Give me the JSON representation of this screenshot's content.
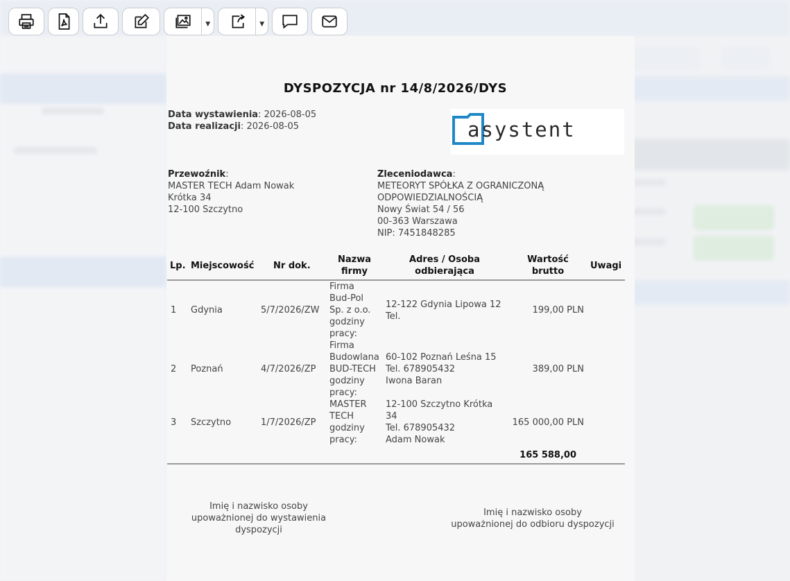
{
  "toolbar": {
    "buttons": [
      {
        "name": "print-button",
        "icon": "printer-icon"
      },
      {
        "name": "pdf-button",
        "icon": "pdf-icon"
      },
      {
        "name": "export-button",
        "icon": "upload-icon"
      },
      {
        "name": "edit-button",
        "icon": "edit-icon"
      },
      {
        "name": "image-button",
        "icon": "image-icon"
      },
      {
        "name": "share-button",
        "icon": "share-icon"
      },
      {
        "name": "comment-button",
        "icon": "comment-icon"
      },
      {
        "name": "email-button",
        "icon": "envelope-icon"
      }
    ]
  },
  "document": {
    "title": "DYSPOZYCJA nr 14/8/2026/DYS",
    "issue_date_label": "Data wystawienia",
    "issue_date": "2026-08-05",
    "realization_date_label": "Data realizacji",
    "realization_date": "2026-08-05",
    "logo_text": "asystent",
    "carrier": {
      "label": "Przewoźnik",
      "lines": [
        "MASTER TECH Adam Nowak",
        "Krótka 34",
        "12-100 Szczytno"
      ]
    },
    "client": {
      "label": "Zleceniodawca",
      "lines": [
        "METEORYT SPÓŁKA Z OGRANICZONĄ",
        "ODPOWIEDZIALNOŚCIĄ",
        "Nowy Świat 54 / 56",
        "00-363 Warszawa",
        "NIP: 7451848285"
      ]
    },
    "table": {
      "headers": {
        "lp": "Lp.",
        "city": "Miejscowość",
        "doc_no": "Nr dok.",
        "company_1": "Nazwa",
        "company_2": "firmy",
        "address_1": "Adres / Osoba",
        "address_2": "odbierająca",
        "value_1": "Wartość",
        "value_2": "brutto",
        "notes": "Uwagi"
      },
      "rows": [
        {
          "lp": "1",
          "city": "Gdynia",
          "doc_no": "5/7/2026/ZW",
          "company": [
            "Firma",
            "Bud-Pol",
            "Sp. z o.o.",
            "godziny",
            "pracy:"
          ],
          "address": [
            "12-122 Gdynia Lipowa 12",
            "Tel."
          ],
          "value": "199,00 PLN",
          "notes": ""
        },
        {
          "lp": "2",
          "city": "Poznań",
          "doc_no": "4/7/2026/ZP",
          "company": [
            "Firma",
            "Budowlana",
            "BUD-TECH",
            "godziny",
            "pracy:"
          ],
          "address": [
            "60-102 Poznań Leśna 15",
            "Tel. 678905432",
            "Iwona Baran"
          ],
          "value": "389,00 PLN",
          "notes": ""
        },
        {
          "lp": "3",
          "city": "Szczytno",
          "doc_no": "1/7/2026/ZP",
          "company": [
            "MASTER",
            "TECH",
            "godziny",
            "pracy:"
          ],
          "address": [
            "12-100 Szczytno Krótka",
            "34",
            "Tel. 678905432",
            "Adam Nowak"
          ],
          "value": "165 000,00 PLN",
          "notes": ""
        }
      ],
      "total": "165 588,00"
    },
    "signature_left": [
      "Imię i nazwisko osoby",
      "upoważnionej do wystawienia",
      "dyspozycji"
    ],
    "signature_right": [
      "Imię i nazwisko osoby",
      "upoważnionej do odbioru dyspozycji"
    ]
  },
  "colors": {
    "logo_blue": "#1e88c7",
    "logo_dark": "#2a2a2a",
    "rule": "#9a9a9a"
  }
}
